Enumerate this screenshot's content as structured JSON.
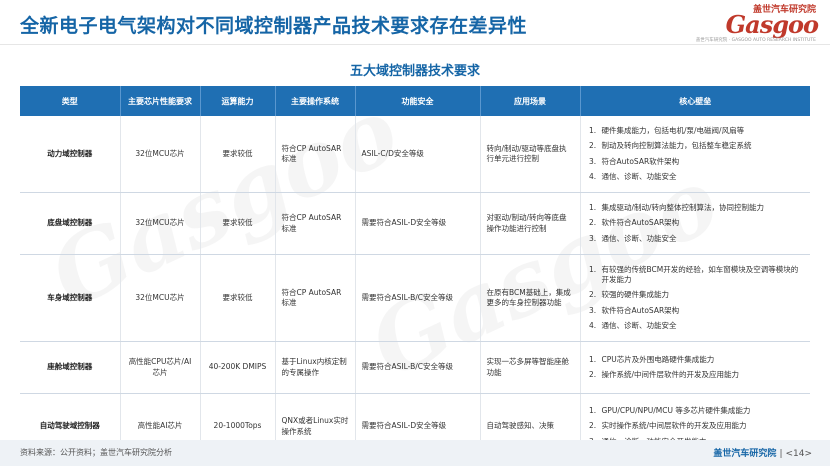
{
  "page": {
    "title": "全新电子电气架构对不同域控制器产品技术要求存在差异性"
  },
  "logo": {
    "top_text": "盖世汽车研究院",
    "word": "Gasgoo",
    "sub_text": "盖世汽车研究院 · GASGOO AUTO RESEARCH INSTITUTE",
    "brand_color": "#c0392b"
  },
  "table": {
    "title": "五大域控制器技术要求",
    "headers": [
      "类型",
      "主要芯片性能要求",
      "运算能力",
      "主要操作系统",
      "功能安全",
      "应用场景",
      "核心壁垒"
    ],
    "rows": [
      {
        "type": "动力域控制器",
        "chip": "32位MCU芯片",
        "compute": "要求较低",
        "os": "符合CP AutoSAR标准",
        "safety": "ASIL-C/D安全等级",
        "scenario": "转向/制动/驱动等底盘执行单元进行控制",
        "barriers": [
          "硬件集成能力，包括电机/泵/电磁阀/风扇等",
          "制动及转向控制算法能力，包括整车稳定系统",
          "符合AutoSAR软件架构",
          "通信、诊断、功能安全"
        ]
      },
      {
        "type": "底盘域控制器",
        "chip": "32位MCU芯片",
        "compute": "要求较低",
        "os": "符合CP AutoSAR标准",
        "safety": "需要符合ASIL-D安全等级",
        "scenario": "对驱动/制动/转向等底盘操作功能进行控制",
        "barriers": [
          "集成驱动/制动/转向整体控制算法，协同控制能力",
          "软件符合AutoSAR架构",
          "通信、诊断、功能安全"
        ]
      },
      {
        "type": "车身域控制器",
        "chip": "32位MCU芯片",
        "compute": "要求较低",
        "os": "符合CP AutoSAR标准",
        "safety": "需要符合ASIL-B/C安全等级",
        "scenario": "在原有BCM基础上，集成更多的车身控制器功能",
        "barriers": [
          "有较强的传统BCM开发的经验，如车窗模块及空调等模块的开发能力",
          "较强的硬件集成能力",
          "软件符合AutoSAR架构",
          "通信、诊断、功能安全"
        ]
      },
      {
        "type": "座舱域控制器",
        "chip": "高性能CPU芯片/AI芯片",
        "compute": "40-200K DMIPS",
        "os": "基于Linux内核定制的专属操作",
        "safety": "需要符合ASIL-B/C安全等级",
        "scenario": "实现一芯多屏等智能座舱功能",
        "barriers": [
          "CPU芯片及外围电路硬件集成能力",
          "操作系统/中间件层软件的开发及应用能力"
        ]
      },
      {
        "type": "自动驾驶域控制器",
        "chip": "高性能AI芯片",
        "compute": "20-1000Tops",
        "os": "QNX或者Linux实时操作系统",
        "safety": "需要符合ASIL-D安全等级",
        "scenario": "自动驾驶感知、决策",
        "barriers": [
          "GPU/CPU/NPU/MCU 等多芯片硬件集成能力",
          "实时操作系统/中间层软件的开发及应用能力",
          "通信、诊断、功能安全开发能力"
        ]
      }
    ]
  },
  "footer": {
    "source": "资料来源：公开资料；盖世汽车研究院分析",
    "brand": "盖世汽车研究院",
    "page": "<14>"
  },
  "colors": {
    "accent": "#1565a6",
    "header_bg": "#1f6fb3"
  }
}
